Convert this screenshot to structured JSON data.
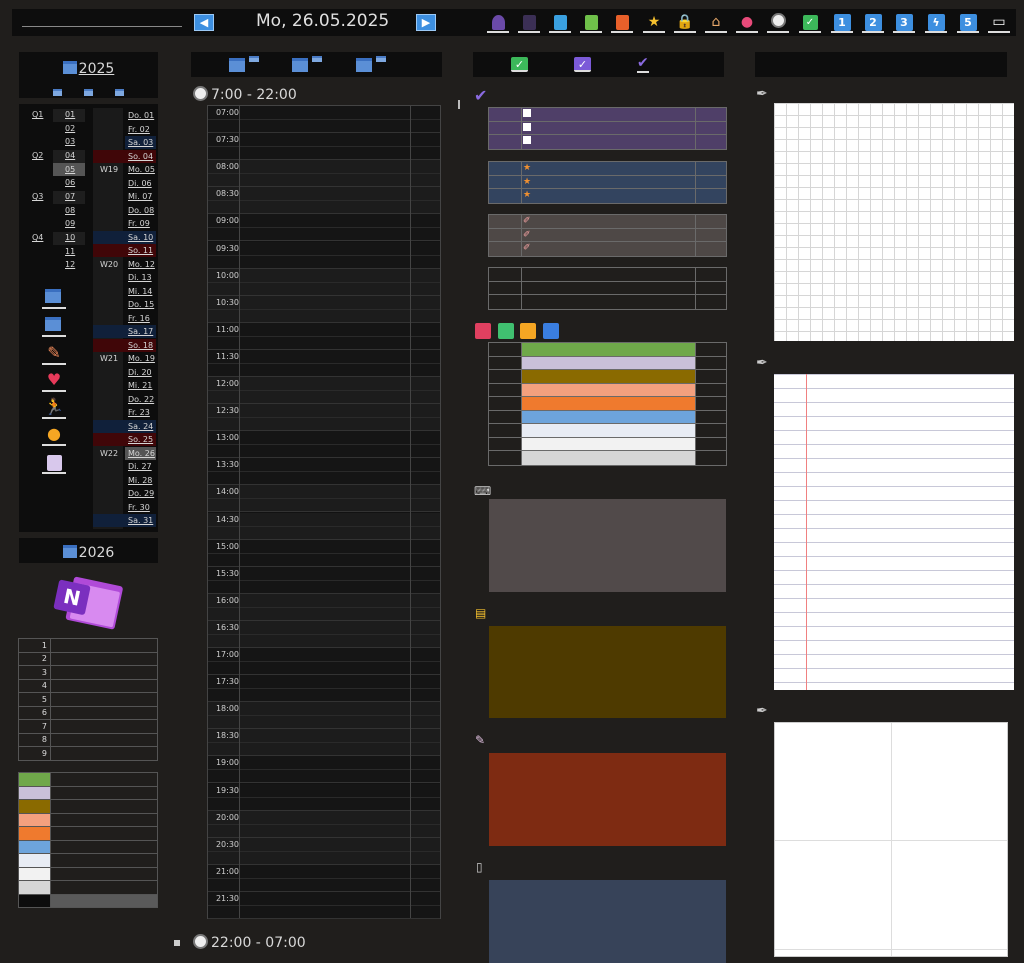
{
  "header": {
    "date": "Mo, 26.05.2025"
  },
  "calendar_2025": {
    "year": "2025",
    "quarters": [
      "Q1",
      "Q2",
      "Q3",
      "Q4"
    ],
    "months": [
      "01",
      "02",
      "03",
      "04",
      "05",
      "06",
      "07",
      "08",
      "09",
      "10",
      "11",
      "12"
    ],
    "weeks": [
      "W19",
      "W20",
      "W21",
      "W22"
    ],
    "days": [
      "Do. 01",
      "Fr. 02",
      "Sa. 03",
      "So. 04",
      "Mo. 05",
      "Di. 06",
      "Mi. 07",
      "Do. 08",
      "Fr. 09",
      "Sa. 10",
      "So. 11",
      "Mo. 12",
      "Di. 13",
      "Mi. 14",
      "Do. 15",
      "Fr. 16",
      "Sa. 17",
      "So. 18",
      "Mo. 19",
      "Di. 20",
      "Mi. 21",
      "Do. 22",
      "Fr. 23",
      "Sa. 24",
      "So. 25",
      "Mo. 26",
      "Di. 27",
      "Mi. 28",
      "Do. 29",
      "Fr. 30",
      "Sa. 31"
    ]
  },
  "calendar_2026": {
    "year": "2026"
  },
  "numbered_rows": [
    "1",
    "2",
    "3",
    "4",
    "5",
    "6",
    "7",
    "8",
    "9"
  ],
  "color_swatches": [
    "#6fa84a",
    "#c9c0d9",
    "#8a6a00",
    "#f3a07e",
    "#ef7a2e",
    "#6da4dc",
    "#e8ecf4",
    "#f2f2f2",
    "#d6d6d6",
    "#0d0d0d"
  ],
  "day_view": {
    "range_day": "7:00 - 22:00",
    "range_night": "22:00 - 07:00",
    "hours": [
      "07:00",
      "07:30",
      "08:00",
      "08:30",
      "09:00",
      "09:30",
      "10:00",
      "10:30",
      "11:00",
      "11:30",
      "12:00",
      "12:30",
      "13:00",
      "13:30",
      "14:00",
      "14:30",
      "15:00",
      "15:30",
      "16:00",
      "16:30",
      "17:00",
      "17:30",
      "18:00",
      "18:30",
      "19:00",
      "19:30",
      "20:00",
      "20:30",
      "21:00",
      "21:30"
    ]
  },
  "colors": {
    "accent": "#3d8fe0",
    "todo_purple": "#4f3f68",
    "star_blue": "#33445f",
    "pen_gray": "#4e4846",
    "note_gray": "#514a4a",
    "note_olive": "#4e3a00",
    "note_rust": "#7e2b12",
    "note_slate": "#374359",
    "tag_colors": [
      "#6fa84a",
      "#c9c0d9",
      "#8a6a00",
      "#f3a07e",
      "#ef7a2e",
      "#6da4dc",
      "#e8ecf4",
      "#f2f2f2",
      "#d6d6d6"
    ]
  }
}
